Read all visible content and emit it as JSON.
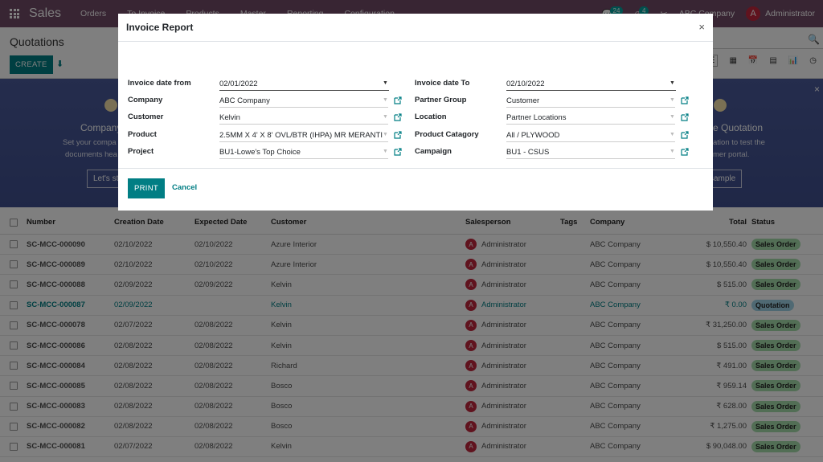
{
  "navbar": {
    "app_name": "Sales",
    "menu": [
      "Orders",
      "To Invoice",
      "Products",
      "Master",
      "Reporting",
      "Configuration"
    ],
    "messages_count": "24",
    "activities_count": "4",
    "company": "ABC Company",
    "user": "Administrator",
    "user_initial": "A"
  },
  "control": {
    "title": "Quotations",
    "create_label": "CREATE",
    "views": [
      "list-view",
      "kanban-view",
      "calendar-view",
      "pivot-view",
      "graph-view",
      "activity-view"
    ]
  },
  "banner": {
    "left_title": "Company",
    "left_text_1": "Set your compa",
    "left_text_2": "documents hea",
    "left_button": "Let's st",
    "right_title": "e Quotation",
    "right_text_1": "ation to test the",
    "right_text_2": "mer portal.",
    "right_button": "l sample",
    "close": "×"
  },
  "list": {
    "columns": [
      "Number",
      "Creation Date",
      "Expected Date",
      "Customer",
      "Salesperson",
      "Tags",
      "Company",
      "Total",
      "Status"
    ],
    "rows": [
      {
        "number": "SC-MCC-000090",
        "creation": "02/10/2022",
        "expected": "02/10/2022",
        "customer": "Azure Interior",
        "salesperson": "Administrator",
        "company": "ABC Company",
        "total": "$ 10,550.40",
        "status": "Sales Order"
      },
      {
        "number": "SC-MCC-000089",
        "creation": "02/10/2022",
        "expected": "02/10/2022",
        "customer": "Azure Interior",
        "salesperson": "Administrator",
        "company": "ABC Company",
        "total": "$ 10,550.40",
        "status": "Sales Order"
      },
      {
        "number": "SC-MCC-000088",
        "creation": "02/09/2022",
        "expected": "02/09/2022",
        "customer": "Kelvin",
        "salesperson": "Administrator",
        "company": "ABC Company",
        "total": "$ 515.00",
        "status": "Sales Order"
      },
      {
        "number": "SC-MCC-000087",
        "creation": "02/09/2022",
        "expected": "",
        "customer": "Kelvin",
        "salesperson": "Administrator",
        "company": "ABC Company",
        "total": "₹ 0.00",
        "status": "Quotation"
      },
      {
        "number": "SC-MCC-000078",
        "creation": "02/07/2022",
        "expected": "02/08/2022",
        "customer": "Kelvin",
        "salesperson": "Administrator",
        "company": "ABC Company",
        "total": "₹ 31,250.00",
        "status": "Sales Order"
      },
      {
        "number": "SC-MCC-000086",
        "creation": "02/08/2022",
        "expected": "02/08/2022",
        "customer": "Kelvin",
        "salesperson": "Administrator",
        "company": "ABC Company",
        "total": "$ 515.00",
        "status": "Sales Order"
      },
      {
        "number": "SC-MCC-000084",
        "creation": "02/08/2022",
        "expected": "02/08/2022",
        "customer": "Richard",
        "salesperson": "Administrator",
        "company": "ABC Company",
        "total": "₹ 491.00",
        "status": "Sales Order"
      },
      {
        "number": "SC-MCC-000085",
        "creation": "02/08/2022",
        "expected": "02/08/2022",
        "customer": "Bosco",
        "salesperson": "Administrator",
        "company": "ABC Company",
        "total": "₹ 959.14",
        "status": "Sales Order"
      },
      {
        "number": "SC-MCC-000083",
        "creation": "02/08/2022",
        "expected": "02/08/2022",
        "customer": "Bosco",
        "salesperson": "Administrator",
        "company": "ABC Company",
        "total": "₹ 628.00",
        "status": "Sales Order"
      },
      {
        "number": "SC-MCC-000082",
        "creation": "02/08/2022",
        "expected": "02/08/2022",
        "customer": "Bosco",
        "salesperson": "Administrator",
        "company": "ABC Company",
        "total": "₹ 1,275.00",
        "status": "Sales Order"
      },
      {
        "number": "SC-MCC-000081",
        "creation": "02/07/2022",
        "expected": "02/08/2022",
        "customer": "Kelvin",
        "salesperson": "Administrator",
        "company": "ABC Company",
        "total": "$ 90,048.00",
        "status": "Sales Order"
      }
    ]
  },
  "dialog": {
    "title": "Invoice Report",
    "close": "×",
    "fields_left": [
      {
        "label": "Invoice date from",
        "value": "02/01/2022",
        "type": "date"
      },
      {
        "label": "Company",
        "value": "ABC Company",
        "type": "many2one"
      },
      {
        "label": "Customer",
        "value": "Kelvin",
        "type": "many2one"
      },
      {
        "label": "Product",
        "value": "2.5MM X 4' X 8' OVL/BTR (IHPA) MR MERANTI",
        "type": "many2one"
      },
      {
        "label": "Project",
        "value": "BU1-Lowe's Top Choice",
        "type": "many2one"
      }
    ],
    "fields_right": [
      {
        "label": "Invoice date To",
        "value": "02/10/2022",
        "type": "date"
      },
      {
        "label": "Partner Group",
        "value": "Customer",
        "type": "many2one"
      },
      {
        "label": "Location",
        "value": "Partner Locations",
        "type": "many2one"
      },
      {
        "label": "Product Catagory",
        "value": "All / PLYWOOD",
        "type": "many2one"
      },
      {
        "label": "Campaign",
        "value": "BU1 - CSUS",
        "type": "many2one"
      }
    ],
    "print_label": "PRINT",
    "cancel_label": "Cancel"
  },
  "colors": {
    "brand": "#714b67",
    "primary": "#017e84",
    "sales_order_badge": "#a4dcaa",
    "quotation_badge": "#9fd3e6",
    "avatar": "#c0263d"
  }
}
